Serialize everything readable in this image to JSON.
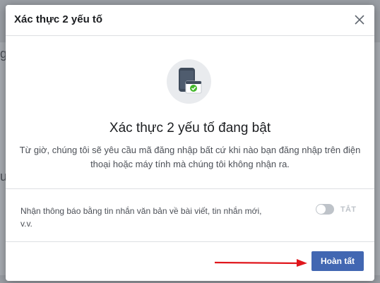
{
  "dialog": {
    "title": "Xác thực 2 yếu tố",
    "close_icon": "close-icon",
    "hero_icon": "phone-laptop-check-icon",
    "headline": "Xác thực 2 yếu tố đang bật",
    "description_line1": "Từ giờ, chúng tôi sẽ yêu cầu mã đăng nhập bất cứ khi nào bạn đăng nhập trên điện",
    "description_line2": "thoại hoặc máy tính mà chúng tôi không nhận ra.",
    "notify_text_line1": "Nhận thông báo bằng tin nhắn văn bản về bài viết, tin nhắn mới,",
    "notify_text_line2": "v.v.",
    "toggle": {
      "state": "off",
      "label": "TẮT"
    },
    "done_button": "Hoàn tất"
  },
  "background": {
    "peek_letters": [
      "g",
      "u"
    ]
  },
  "colors": {
    "primary_button": "#4267b2",
    "annotation_arrow": "#e0161c",
    "check_green": "#42b72a",
    "toggle_off": "#bec3c9",
    "overlay": "#9a9ea4"
  }
}
